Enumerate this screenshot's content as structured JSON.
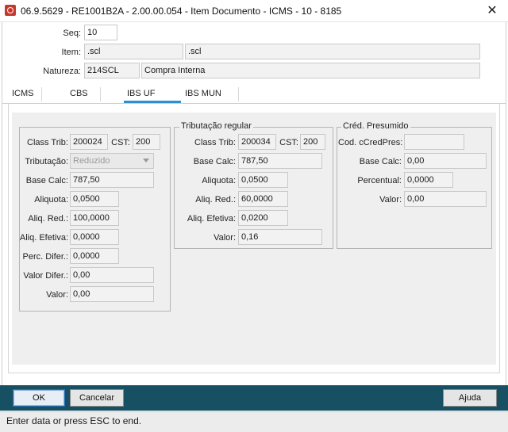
{
  "window": {
    "title": "06.9.5629 - RE1001B2A - 2.00.00.054 - Item Documento - ICMS - 10 - 8185",
    "close_glyph": "✕"
  },
  "header": {
    "seq_label": "Seq:",
    "seq_value": "10",
    "item_label": "Item:",
    "item_code": ".scl",
    "item_desc": ".scl",
    "natureza_label": "Natureza:",
    "natureza_code": "214SCL",
    "natureza_desc": "Compra Interna"
  },
  "tabs": [
    {
      "label": "ICMS"
    },
    {
      "label": "CBS"
    },
    {
      "label": "IBS UF",
      "active": true
    },
    {
      "label": "IBS MUN"
    }
  ],
  "left_group": {
    "class_trib_label": "Class Trib:",
    "class_trib_value": "200024",
    "cst_label": "CST:",
    "cst_value": "200",
    "tributacao_label": "Tributação:",
    "tributacao_value": "Reduzido",
    "base_calc_label": "Base Calc:",
    "base_calc_value": "787,50",
    "aliquota_label": "Aliquota:",
    "aliquota_value": "0,0500",
    "aliq_red_label": "Aliq. Red.:",
    "aliq_red_value": "100,0000",
    "aliq_efetiva_label": "Aliq. Efetiva:",
    "aliq_efetiva_value": "0,0000",
    "perc_difer_label": "Perc. Difer.:",
    "perc_difer_value": "0,0000",
    "valor_difer_label": "Valor Difer.:",
    "valor_difer_value": "0,00",
    "valor_label": "Valor:",
    "valor_value": "0,00"
  },
  "mid_group": {
    "title": "Tributação regular",
    "class_trib_label": "Class Trib:",
    "class_trib_value": "200034",
    "cst_label": "CST:",
    "cst_value": "200",
    "base_calc_label": "Base Calc:",
    "base_calc_value": "787,50",
    "aliquota_label": "Aliquota:",
    "aliquota_value": "0,0500",
    "aliq_red_label": "Aliq. Red.:",
    "aliq_red_value": "60,0000",
    "aliq_efetiva_label": "Aliq. Efetiva:",
    "aliq_efetiva_value": "0,0200",
    "valor_label": "Valor:",
    "valor_value": "0,16"
  },
  "right_group": {
    "title": "Créd. Presumido",
    "cod_label": "Cod. cCredPres:",
    "cod_value": "",
    "base_calc_label": "Base Calc:",
    "base_calc_value": "0,00",
    "percentual_label": "Percentual:",
    "percentual_value": "0,0000",
    "valor_label": "Valor:",
    "valor_value": "0,00"
  },
  "buttons": {
    "ok": "OK",
    "cancel": "Cancelar",
    "help": "Ajuda"
  },
  "status": {
    "text": "Enter data or press ESC to end."
  },
  "colors": {
    "bottom_bar": "#174f63",
    "active_tab_underline": "#2b8fd1",
    "app_icon": "#c8372d"
  }
}
